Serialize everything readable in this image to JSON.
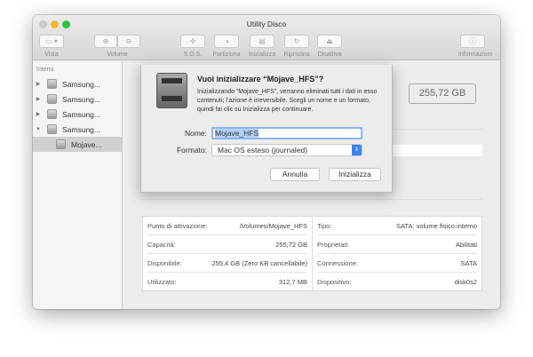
{
  "window": {
    "title": "Utility Disco"
  },
  "toolbar": {
    "vista": "Vista",
    "volume": "Volume",
    "sos": "S.O.S.",
    "partiziona": "Partiziona",
    "inizializza": "Inizializza",
    "ripristina": "Ripristina",
    "disattiva": "Disattiva",
    "informazioni": "Informazioni"
  },
  "sidebar": {
    "header": "Interni",
    "items": [
      {
        "label": "Samsung..."
      },
      {
        "label": "Samsung..."
      },
      {
        "label": "Samsung..."
      },
      {
        "label": "Samsung..."
      },
      {
        "label": "Mojave..."
      }
    ]
  },
  "main": {
    "capacity": "255,72 GB"
  },
  "info": {
    "left": [
      {
        "k": "Punto di attivazione:",
        "v": "/Volumes/Mojave_HFS"
      },
      {
        "k": "Capacità:",
        "v": "255,72 GB"
      },
      {
        "k": "Disponibile:",
        "v": "255,4 GB (Zero KB cancellabile)"
      },
      {
        "k": "Utilizzato:",
        "v": "312,7 MB"
      }
    ],
    "right": [
      {
        "k": "Tipo:",
        "v": "SATA: volume fisico interno"
      },
      {
        "k": "Proprietari:",
        "v": "Abilitati"
      },
      {
        "k": "Connessione:",
        "v": "SATA"
      },
      {
        "k": "Dispositivo:",
        "v": "disk0s2"
      }
    ]
  },
  "dialog": {
    "title": "Vuoi inizializzare “Mojave_HFS”?",
    "message": "Inizializzando “Mojave_HFS”, verranno eliminati tutti i dati in esso contenuti; l’azione è irreversibile. Scegli un nome e un formato, quindi fai clic su Inizializza per continuare.",
    "name_label": "Nome:",
    "name_value": "Mojave_HFS",
    "format_label": "Formato:",
    "format_value": "Mac OS esteso (journaled)",
    "cancel": "Annulla",
    "confirm": "Inizializza"
  }
}
